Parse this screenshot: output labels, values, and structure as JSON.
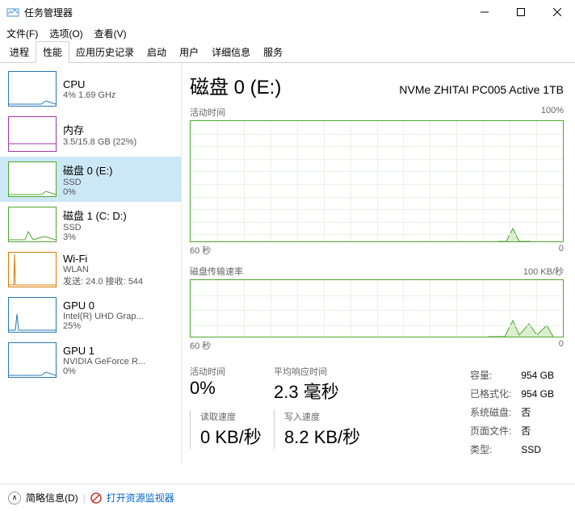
{
  "window": {
    "title": "任务管理器"
  },
  "menus": {
    "file": "文件(F)",
    "options": "选项(O)",
    "view": "查看(V)"
  },
  "tabs": [
    "进程",
    "性能",
    "应用历史记录",
    "启动",
    "用户",
    "详细信息",
    "服务"
  ],
  "active_tab_index": 1,
  "selected_side_index": 2,
  "sidebar": [
    {
      "name": "CPU",
      "sub1": "4% 1.69 GHz",
      "sub2": "",
      "color": "cpu"
    },
    {
      "name": "内存",
      "sub1": "3.5/15.8 GB (22%)",
      "sub2": "",
      "color": "mem"
    },
    {
      "name": "磁盘 0 (E:)",
      "sub1": "SSD",
      "sub2": "0%",
      "color": "disk"
    },
    {
      "name": "磁盘 1 (C: D:)",
      "sub1": "SSD",
      "sub2": "3%",
      "color": "disk"
    },
    {
      "name": "Wi-Fi",
      "sub1": "WLAN",
      "sub2": "发送: 24.0 接收: 544",
      "color": "wifi"
    },
    {
      "name": "GPU 0",
      "sub1": "Intel(R) UHD Grap...",
      "sub2": "25%",
      "color": "gpu"
    },
    {
      "name": "GPU 1",
      "sub1": "NVIDIA GeForce R...",
      "sub2": "0%",
      "color": "gpu"
    }
  ],
  "main": {
    "title": "磁盘 0 (E:)",
    "model": "NVMe ZHITAI PC005 Active 1TB",
    "chart1": {
      "label_left": "活动时间",
      "label_right": "100%",
      "axis_left": "60 秒",
      "axis_right": "0"
    },
    "chart2": {
      "label_left": "磁盘传输速率",
      "label_right": "100 KB/秒",
      "axis_left": "60 秒",
      "axis_right": "0"
    },
    "stats": {
      "active_time_label": "活动时间",
      "active_time": "0%",
      "avg_response_label": "平均响应时间",
      "avg_response": "2.3 毫秒",
      "read_speed_label": "读取速度",
      "read_speed": "0 KB/秒",
      "write_speed_label": "写入速度",
      "write_speed": "8.2 KB/秒"
    },
    "props": {
      "capacity_label": "容量:",
      "capacity": "954 GB",
      "formatted_label": "已格式化:",
      "formatted": "954 GB",
      "system_disk_label": "系统磁盘:",
      "system_disk": "否",
      "pagefile_label": "页面文件:",
      "pagefile": "否",
      "type_label": "类型:",
      "type": "SSD"
    }
  },
  "footer": {
    "brief": "简略信息(D)",
    "resmon": "打开资源监视器"
  }
}
